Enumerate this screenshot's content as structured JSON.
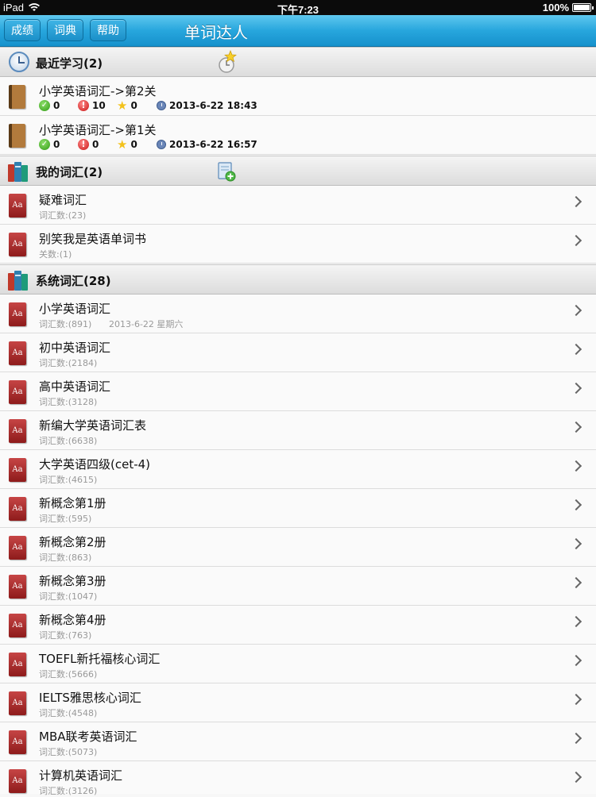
{
  "status_bar": {
    "device": "iPad",
    "time": "下午7:23",
    "battery": "100%"
  },
  "nav": {
    "btn_scores": "成绩",
    "btn_dict": "词典",
    "btn_help": "帮助",
    "title": "单词达人"
  },
  "recent": {
    "header": "最近学习(2)",
    "items": [
      {
        "title": "小学英语词汇->第2关",
        "correct": "0",
        "wrong": "10",
        "starred": "0",
        "time": "2013-6-22 18:43"
      },
      {
        "title": "小学英语词汇->第1关",
        "correct": "0",
        "wrong": "0",
        "starred": "0",
        "time": "2013-6-22 16:57"
      }
    ]
  },
  "mine": {
    "header": "我的词汇(2)",
    "items": [
      {
        "title": "疑难词汇",
        "sub": "词汇数:(23)"
      },
      {
        "title": "别笑我是英语单词书",
        "sub": "关数:(1)"
      }
    ]
  },
  "system": {
    "header": "系统词汇(28)",
    "items": [
      {
        "title": "小学英语词汇",
        "sub": "词汇数:(891)",
        "date": "2013-6-22 星期六"
      },
      {
        "title": "初中英语词汇",
        "sub": "词汇数:(2184)"
      },
      {
        "title": "高中英语词汇",
        "sub": "词汇数:(3128)"
      },
      {
        "title": "新编大学英语词汇表",
        "sub": "词汇数:(6638)"
      },
      {
        "title": "大学英语四级(cet-4)",
        "sub": "词汇数:(4615)"
      },
      {
        "title": "新概念第1册",
        "sub": "词汇数:(595)"
      },
      {
        "title": "新概念第2册",
        "sub": "词汇数:(863)"
      },
      {
        "title": "新概念第3册",
        "sub": "词汇数:(1047)"
      },
      {
        "title": "新概念第4册",
        "sub": "词汇数:(763)"
      },
      {
        "title": "TOEFL新托福核心词汇",
        "sub": "词汇数:(5666)"
      },
      {
        "title": "IELTS雅思核心词汇",
        "sub": "词汇数:(4548)"
      },
      {
        "title": "MBA联考英语词汇",
        "sub": "词汇数:(5073)"
      },
      {
        "title": "计算机英语词汇",
        "sub": "词汇数:(3126)"
      }
    ]
  },
  "icons": {
    "dict_icon_text": "Aa"
  },
  "colors": {
    "nav_top": "#5fc8ef",
    "nav_bottom": "#1691cc",
    "dict_red": "#8e1b1b"
  }
}
